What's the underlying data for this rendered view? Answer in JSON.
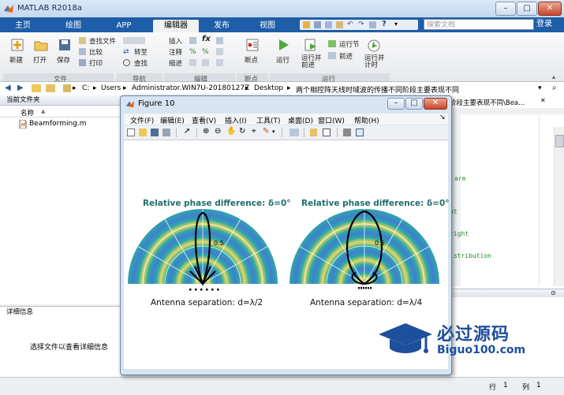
{
  "window": {
    "title": "MATLAB R2018a"
  },
  "tabs": [
    {
      "label": "主页",
      "active": false
    },
    {
      "label": "绘图",
      "active": false
    },
    {
      "label": "APP",
      "active": false
    },
    {
      "label": "编辑器",
      "active": true
    },
    {
      "label": "发布",
      "active": false
    },
    {
      "label": "视图",
      "active": false
    }
  ],
  "search": {
    "placeholder": "搜索文档"
  },
  "login": "登录",
  "ribbon": {
    "new": "新建",
    "open": "打开",
    "save": "保存",
    "find_files": "查找文件",
    "compare": "比较",
    "print": "打印",
    "goto": "转至",
    "find": "查找",
    "insert": "插入",
    "comment": "注释",
    "indent": "缩进",
    "fx": "fx",
    "breakpoints": "断点",
    "run": "运行",
    "run_advance": "运行并\n前进",
    "run_section": "运行节",
    "advance": "前进",
    "run_time": "运行并\n计时",
    "groups": {
      "file": "文件",
      "navigate": "导航",
      "edit": "编辑",
      "breakpoints": "断点",
      "run": "运行"
    }
  },
  "address": {
    "segments": [
      "C:",
      "Users",
      "Administrator.WIN7U-20180127Z",
      "Desktop",
      "两个相控阵天线时域波的传播不同阶段主要表现不同"
    ]
  },
  "current_folder": {
    "header": "当前文件夹",
    "column": "名称",
    "files": [
      "Beamforming.m"
    ]
  },
  "details": {
    "header": "详细信息",
    "empty_text": "选择文件以查看详细信息"
  },
  "editor": {
    "path_fragment": "阶段主要表现不同\\Bea...",
    "code_fragments": [
      "are",
      "ht",
      "right",
      "istribution"
    ]
  },
  "figure": {
    "title": "Figure 10",
    "menu": [
      "文件(F)",
      "编辑(E)",
      "查看(V)",
      "插入(I)",
      "工具(T)",
      "桌面(D)",
      "窗口(W)",
      "帮助(H)"
    ],
    "plots": [
      {
        "title": "Relative phase difference: δ=0°",
        "tick": "0.5",
        "caption": "Antenna separation: d=λ/2"
      },
      {
        "title": "Relative phase difference: δ=0°",
        "tick": "0.5",
        "caption": "Antenna separation: d=λ/4"
      }
    ]
  },
  "status": {
    "row_label": "行",
    "row": "1",
    "col_label": "列",
    "col": "1"
  },
  "watermark": {
    "brand": "必过源码",
    "url": "Biguo100.com"
  }
}
